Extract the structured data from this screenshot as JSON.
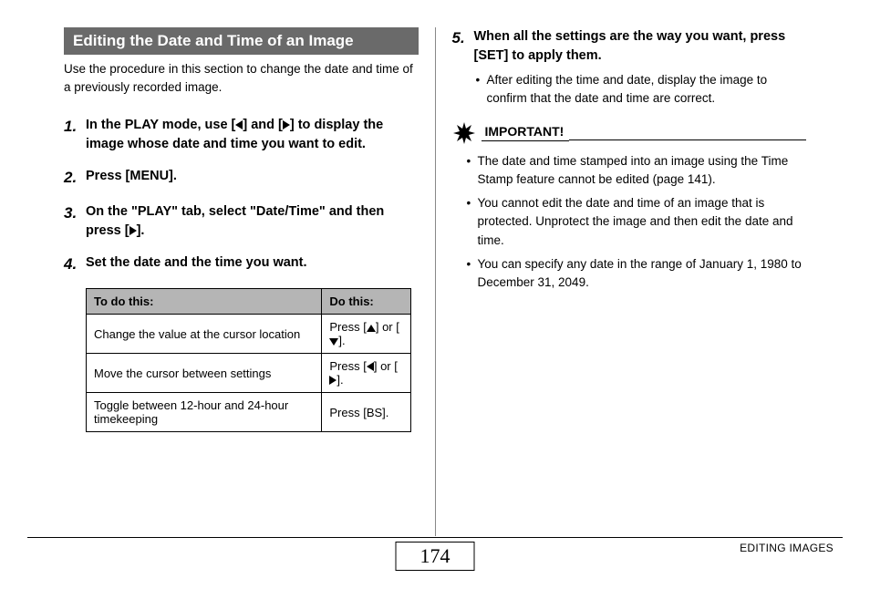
{
  "section_title": "Editing the Date and Time of an Image",
  "intro": "Use the procedure in this section to change the date and time of a previously recorded image.",
  "steps": {
    "s1": {
      "num": "1.",
      "pre": "In the PLAY mode, use [",
      "mid": "] and [",
      "post": "] to display the image whose date and time you want to edit."
    },
    "s2": {
      "num": "2.",
      "text": "Press [MENU]."
    },
    "s3": {
      "num": "3.",
      "pre": "On the \"PLAY\" tab, select \"Date/Time\" and then press [",
      "post": "]."
    },
    "s4": {
      "num": "4.",
      "text": "Set the date and the time you want."
    },
    "s5": {
      "num": "5.",
      "text": "When all the settings are the way you want, press [SET] to apply them.",
      "sub": "After editing the time and date, display the image to confirm that the date and time are correct."
    }
  },
  "table": {
    "head": {
      "c1": "To do this:",
      "c2": "Do this:"
    },
    "rows": [
      {
        "c1": "Change the value at the cursor location",
        "c2_pre": "Press [",
        "c2_mid": "] or [",
        "c2_post": "].",
        "icon1": "up",
        "icon2": "down"
      },
      {
        "c1": "Move the cursor between settings",
        "c2_pre": "Press [",
        "c2_mid": "] or [",
        "c2_post": "].",
        "icon1": "left",
        "icon2": "right"
      },
      {
        "c1": "Toggle between 12-hour and 24-hour timekeeping",
        "c2_plain": "Press [BS]."
      }
    ]
  },
  "important": {
    "label": "IMPORTANT!",
    "items": [
      "The date and time stamped into an image using the Time Stamp feature cannot be edited (page 141).",
      "You cannot edit the date and time of an image that is protected. Unprotect the image and then edit the date and time.",
      "You can specify any date in the range of January 1, 1980 to December 31, 2049."
    ]
  },
  "footer": {
    "page": "174",
    "right": "EDITING IMAGES"
  }
}
